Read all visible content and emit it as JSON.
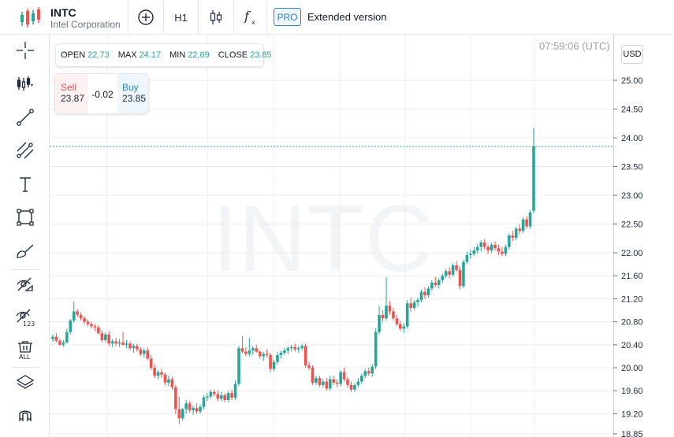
{
  "header": {
    "symbol": "INTC",
    "company": "Intel Corporation",
    "timeframe": "H1",
    "pro_badge": "PRO",
    "extended_label": "Extended version"
  },
  "sidebar": {
    "items": [
      "crosshair-icon",
      "chart-type-icon",
      "trendline-icon",
      "fibonacci-icon",
      "text-icon",
      "rectangle-icon",
      "brush-icon",
      "hide-drawings-icon",
      "hide-indicators-icon",
      "delete-all-icon",
      "layers-icon",
      "magnet-icon"
    ],
    "delete_all_label": "ALL",
    "indicators_badge": "123"
  },
  "ohlc": {
    "open_label": "OPEN",
    "open": "22.73",
    "max_label": "MAX",
    "max": "24.17",
    "min_label": "MIN",
    "min": "22.69",
    "close_label": "CLOSE",
    "close": "23.85"
  },
  "trade": {
    "sell_label": "Sell",
    "sell_price": "23.87",
    "change": "-0.02",
    "buy_label": "Buy",
    "buy_price": "23.85"
  },
  "time": "07:59:06 (UTC)",
  "currency": "USD",
  "colors": {
    "up": "#26a69a",
    "down": "#ef5350",
    "accent": "#2e86c1"
  },
  "chart_data": {
    "type": "candlestick",
    "watermark": "INTC",
    "y_ticks": [
      "25.00",
      "24.50",
      "24.00",
      "23.50",
      "23.00",
      "22.50",
      "22.00",
      "21.60",
      "21.20",
      "20.80",
      "20.40",
      "20.00",
      "19.60",
      "19.20",
      "18.85"
    ],
    "current_price": 23.85,
    "candles": [
      [
        20.5,
        20.58,
        20.45,
        20.54
      ],
      [
        20.54,
        20.6,
        20.44,
        20.47
      ],
      [
        20.47,
        20.5,
        20.38,
        20.4
      ],
      [
        20.4,
        20.48,
        20.36,
        20.44
      ],
      [
        20.44,
        20.68,
        20.42,
        20.62
      ],
      [
        20.62,
        20.85,
        20.58,
        20.82
      ],
      [
        20.82,
        21.15,
        20.78,
        20.98
      ],
      [
        20.98,
        21.02,
        20.88,
        20.92
      ],
      [
        20.92,
        20.96,
        20.82,
        20.86
      ],
      [
        20.86,
        20.9,
        20.76,
        20.8
      ],
      [
        20.8,
        20.84,
        20.72,
        20.76
      ],
      [
        20.76,
        20.8,
        20.68,
        20.72
      ],
      [
        20.72,
        20.76,
        20.64,
        20.7
      ],
      [
        20.7,
        20.74,
        20.58,
        20.6
      ],
      [
        20.6,
        20.66,
        20.44,
        20.48
      ],
      [
        20.48,
        20.62,
        20.44,
        20.58
      ],
      [
        20.58,
        20.64,
        20.38,
        20.42
      ],
      [
        20.42,
        20.5,
        20.36,
        20.46
      ],
      [
        20.46,
        20.52,
        20.38,
        20.42
      ],
      [
        20.42,
        20.5,
        20.36,
        20.44
      ],
      [
        20.44,
        20.62,
        20.38,
        20.4
      ],
      [
        20.4,
        20.48,
        20.34,
        20.42
      ],
      [
        20.42,
        20.46,
        20.3,
        20.34
      ],
      [
        20.34,
        20.42,
        20.26,
        20.38
      ],
      [
        20.38,
        20.42,
        20.28,
        20.32
      ],
      [
        20.32,
        20.36,
        20.2,
        20.24
      ],
      [
        20.24,
        20.34,
        20.18,
        20.3
      ],
      [
        20.3,
        20.36,
        20.12,
        20.16
      ],
      [
        20.16,
        20.22,
        19.96,
        20.0
      ],
      [
        20.0,
        20.06,
        19.82,
        19.86
      ],
      [
        19.86,
        19.96,
        19.8,
        19.92
      ],
      [
        19.92,
        19.98,
        19.82,
        19.88
      ],
      [
        19.88,
        19.92,
        19.7,
        19.74
      ],
      [
        19.74,
        19.86,
        19.68,
        19.8
      ],
      [
        19.8,
        19.84,
        19.62,
        19.66
      ],
      [
        19.66,
        19.7,
        19.2,
        19.28
      ],
      [
        19.28,
        19.5,
        19.02,
        19.12
      ],
      [
        19.12,
        19.3,
        19.08,
        19.28
      ],
      [
        19.28,
        19.44,
        19.2,
        19.38
      ],
      [
        19.38,
        19.42,
        19.22,
        19.26
      ],
      [
        19.26,
        19.34,
        19.18,
        19.3
      ],
      [
        19.3,
        19.38,
        19.2,
        19.24
      ],
      [
        19.24,
        19.36,
        19.2,
        19.32
      ],
      [
        19.32,
        19.52,
        19.28,
        19.48
      ],
      [
        19.48,
        19.56,
        19.42,
        19.5
      ],
      [
        19.5,
        19.62,
        19.46,
        19.58
      ],
      [
        19.58,
        19.62,
        19.5,
        19.54
      ],
      [
        19.54,
        19.6,
        19.42,
        19.46
      ],
      [
        19.46,
        19.58,
        19.42,
        19.52
      ],
      [
        19.52,
        19.56,
        19.4,
        19.44
      ],
      [
        19.44,
        19.6,
        19.4,
        19.56
      ],
      [
        19.56,
        19.62,
        19.44,
        19.48
      ],
      [
        19.48,
        19.78,
        19.44,
        19.72
      ],
      [
        19.72,
        20.38,
        19.68,
        20.34
      ],
      [
        20.34,
        20.55,
        20.25,
        20.28
      ],
      [
        20.28,
        20.36,
        20.2,
        20.24
      ],
      [
        20.24,
        20.52,
        20.2,
        20.3
      ],
      [
        20.3,
        20.38,
        20.22,
        20.34
      ],
      [
        20.34,
        20.4,
        20.26,
        20.28
      ],
      [
        20.28,
        20.3,
        20.16,
        20.2
      ],
      [
        20.2,
        20.28,
        20.12,
        20.24
      ],
      [
        20.24,
        20.32,
        20.18,
        20.22
      ],
      [
        20.22,
        20.26,
        19.92,
        19.98
      ],
      [
        19.98,
        20.14,
        19.94,
        20.1
      ],
      [
        20.1,
        20.28,
        20.06,
        20.22
      ],
      [
        20.22,
        20.3,
        20.16,
        20.26
      ],
      [
        20.26,
        20.34,
        20.22,
        20.3
      ],
      [
        20.3,
        20.38,
        20.24,
        20.34
      ],
      [
        20.34,
        20.4,
        20.28,
        20.36
      ],
      [
        20.36,
        20.42,
        20.28,
        20.32
      ],
      [
        20.32,
        20.38,
        20.26,
        20.34
      ],
      [
        20.34,
        20.42,
        20.3,
        20.38
      ],
      [
        20.38,
        20.42,
        20.0,
        20.04
      ],
      [
        20.04,
        20.1,
        19.96,
        20.0
      ],
      [
        20.0,
        20.04,
        19.7,
        19.74
      ],
      [
        19.74,
        19.86,
        19.7,
        19.82
      ],
      [
        19.82,
        19.86,
        19.66,
        19.7
      ],
      [
        19.7,
        19.8,
        19.66,
        19.76
      ],
      [
        19.76,
        19.82,
        19.6,
        19.64
      ],
      [
        19.64,
        19.86,
        19.6,
        19.8
      ],
      [
        19.8,
        19.86,
        19.7,
        19.74
      ],
      [
        19.74,
        19.8,
        19.66,
        19.72
      ],
      [
        19.72,
        19.96,
        19.68,
        19.92
      ],
      [
        19.92,
        20.0,
        19.76,
        19.8
      ],
      [
        19.8,
        19.84,
        19.66,
        19.7
      ],
      [
        19.7,
        19.76,
        19.58,
        19.62
      ],
      [
        19.62,
        19.74,
        19.58,
        19.7
      ],
      [
        19.7,
        19.82,
        19.66,
        19.76
      ],
      [
        19.76,
        19.9,
        19.72,
        19.86
      ],
      [
        19.86,
        19.98,
        19.82,
        19.94
      ],
      [
        19.94,
        20.0,
        19.86,
        19.9
      ],
      [
        19.9,
        20.06,
        19.84,
        20.02
      ],
      [
        20.02,
        20.68,
        19.98,
        20.62
      ],
      [
        20.62,
        21.08,
        20.58,
        20.92
      ],
      [
        20.92,
        21.0,
        20.8,
        20.86
      ],
      [
        20.86,
        21.58,
        20.82,
        21.08
      ],
      [
        21.08,
        21.16,
        20.92,
        20.98
      ],
      [
        20.98,
        21.04,
        20.82,
        20.86
      ],
      [
        20.86,
        20.92,
        20.72,
        20.76
      ],
      [
        20.76,
        20.82,
        20.64,
        20.68
      ],
      [
        20.68,
        20.78,
        20.6,
        20.72
      ],
      [
        20.72,
        21.18,
        20.68,
        21.12
      ],
      [
        21.12,
        21.22,
        20.98,
        21.04
      ],
      [
        21.04,
        21.18,
        21.0,
        21.14
      ],
      [
        21.14,
        21.22,
        21.06,
        21.18
      ],
      [
        21.18,
        21.36,
        21.14,
        21.32
      ],
      [
        21.32,
        21.4,
        21.2,
        21.26
      ],
      [
        21.26,
        21.42,
        21.22,
        21.38
      ],
      [
        21.38,
        21.52,
        21.34,
        21.48
      ],
      [
        21.48,
        21.58,
        21.4,
        21.44
      ],
      [
        21.44,
        21.56,
        21.38,
        21.52
      ],
      [
        21.52,
        21.64,
        21.48,
        21.6
      ],
      [
        21.6,
        21.72,
        21.56,
        21.68
      ],
      [
        21.68,
        21.74,
        21.56,
        21.62
      ],
      [
        21.62,
        21.82,
        21.58,
        21.78
      ],
      [
        21.78,
        21.86,
        21.66,
        21.7
      ],
      [
        21.7,
        21.76,
        21.36,
        21.42
      ],
      [
        21.42,
        21.88,
        21.38,
        21.84
      ],
      [
        21.84,
        22.02,
        21.8,
        21.96
      ],
      [
        21.96,
        22.06,
        21.9,
        21.98
      ],
      [
        21.98,
        22.1,
        21.94,
        22.04
      ],
      [
        22.04,
        22.16,
        21.98,
        22.1
      ],
      [
        22.1,
        22.22,
        22.02,
        22.18
      ],
      [
        22.18,
        22.24,
        22.06,
        22.1
      ],
      [
        22.1,
        22.14,
        21.98,
        22.04
      ],
      [
        22.04,
        22.18,
        22.0,
        22.14
      ],
      [
        22.14,
        22.2,
        22.04,
        22.08
      ],
      [
        22.08,
        22.14,
        21.96,
        22.02
      ],
      [
        22.02,
        22.1,
        21.94,
        21.98
      ],
      [
        21.98,
        22.14,
        21.94,
        22.1
      ],
      [
        22.1,
        22.34,
        22.06,
        22.3
      ],
      [
        22.3,
        22.38,
        22.2,
        22.26
      ],
      [
        22.26,
        22.46,
        22.22,
        22.42
      ],
      [
        22.42,
        22.5,
        22.32,
        22.38
      ],
      [
        22.38,
        22.62,
        22.34,
        22.58
      ],
      [
        22.58,
        22.64,
        22.42,
        22.46
      ],
      [
        22.46,
        22.74,
        22.42,
        22.7
      ],
      [
        22.73,
        24.17,
        22.69,
        23.85
      ]
    ]
  }
}
